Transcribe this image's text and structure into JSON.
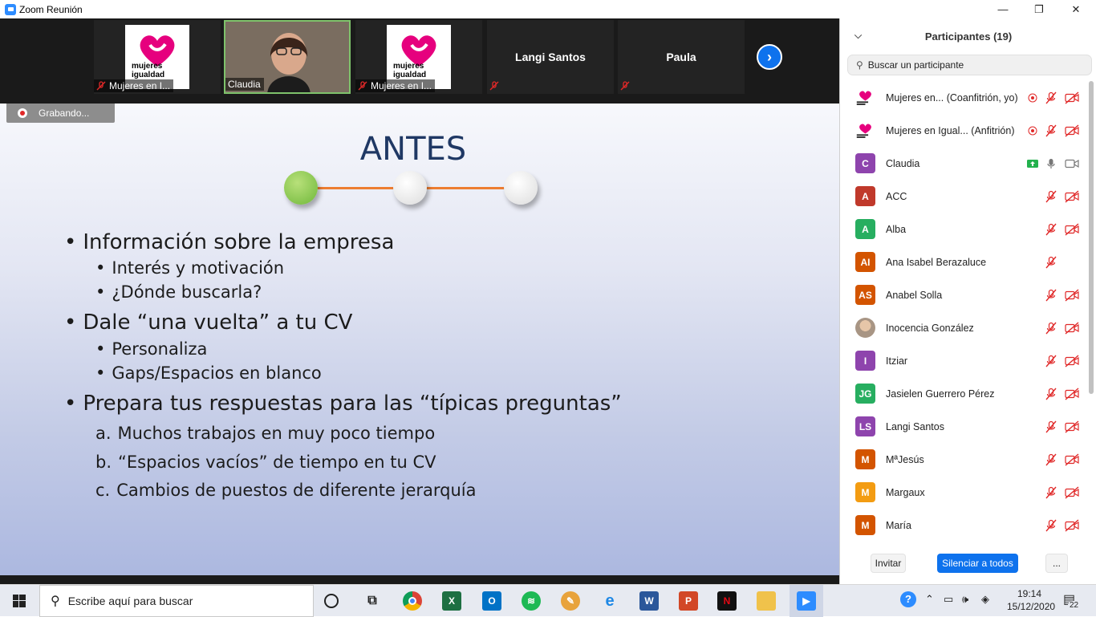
{
  "window": {
    "title": "Zoom Reunión",
    "minimize": "—",
    "maximize": "❐",
    "close": "✕"
  },
  "video_strip": {
    "tiles": [
      {
        "name": "Mujeres en I...",
        "type": "logo",
        "muted": true
      },
      {
        "name": "Claudia",
        "type": "video",
        "muted": false,
        "active": true
      },
      {
        "name": "Mujeres en I...",
        "type": "logo",
        "muted": true
      },
      {
        "name": "Langi Santos",
        "type": "name",
        "muted": true
      },
      {
        "name": "Paula",
        "type": "name",
        "muted": true
      }
    ],
    "logo_text": [
      "mujeres",
      "igualdad"
    ]
  },
  "recording": {
    "label": "Grabando..."
  },
  "slide": {
    "title": "ANTES",
    "bullets": [
      {
        "marker": "•",
        "text": "Información sobre la empresa",
        "level": 1
      },
      {
        "marker": "•",
        "text": "Interés y motivación",
        "level": 2
      },
      {
        "marker": "•",
        "text": "¿Dónde buscarla?",
        "level": 2
      },
      {
        "marker": "•",
        "text": "Dale “una vuelta” a tu CV",
        "level": 1
      },
      {
        "marker": "•",
        "text": "Personaliza",
        "level": 2
      },
      {
        "marker": "•",
        "text": "Gaps/Espacios en blanco",
        "level": 2
      },
      {
        "marker": "•",
        "text": "Prepara tus respuestas para las “típicas preguntas”",
        "level": 1
      },
      {
        "marker": "a.",
        "text": "Muchos trabajos en muy poco tiempo",
        "level": 2
      },
      {
        "marker": "b.",
        "text": "“Espacios vacíos” de tiempo en tu CV",
        "level": 2
      },
      {
        "marker": "c.",
        "text": "Cambios de puestos de diferente jerarquía",
        "level": 2
      }
    ],
    "colors": {
      "title": "#1f3864",
      "line": "#ed7d31",
      "active_dot": "#7dc142"
    }
  },
  "participants": {
    "header": "Participantes (19)",
    "search_placeholder": "Buscar un participante",
    "list": [
      {
        "initials": "",
        "name": "Mujeres en...",
        "role": "(Coanfitrión, yo)",
        "color": "logo",
        "recording": true,
        "mic": "muted",
        "video": "off"
      },
      {
        "initials": "",
        "name": "Mujeres en Igual...",
        "role": "(Anfitrión)",
        "color": "logo",
        "recording": true,
        "mic": "muted",
        "video": "off"
      },
      {
        "initials": "C",
        "name": "Claudia",
        "role": "",
        "color": "#8e44ad",
        "share": true,
        "mic": "on",
        "video": "on"
      },
      {
        "initials": "A",
        "name": "ACC",
        "role": "",
        "color": "#c0392b",
        "mic": "muted",
        "video": "off"
      },
      {
        "initials": "A",
        "name": "Alba",
        "role": "",
        "color": "#27ae60",
        "mic": "muted",
        "video": "off"
      },
      {
        "initials": "AI",
        "name": "Ana Isabel Berazaluce",
        "role": "",
        "color": "#d35400",
        "mic": "muted",
        "video": "none"
      },
      {
        "initials": "AS",
        "name": "Anabel Solla",
        "role": "",
        "color": "#d35400",
        "mic": "muted",
        "video": "off"
      },
      {
        "initials": "",
        "name": "Inocencia González",
        "role": "",
        "color": "photo",
        "mic": "muted",
        "video": "off"
      },
      {
        "initials": "I",
        "name": "Itziar",
        "role": "",
        "color": "#8e44ad",
        "mic": "muted",
        "video": "off"
      },
      {
        "initials": "JG",
        "name": "Jasielen Guerrero Pérez",
        "role": "",
        "color": "#27ae60",
        "mic": "muted",
        "video": "off"
      },
      {
        "initials": "LS",
        "name": "Langi Santos",
        "role": "",
        "color": "#8e44ad",
        "mic": "muted",
        "video": "off"
      },
      {
        "initials": "M",
        "name": "MªJesús",
        "role": "",
        "color": "#d35400",
        "mic": "muted",
        "video": "off"
      },
      {
        "initials": "M",
        "name": "Margaux",
        "role": "",
        "color": "#f39c12",
        "mic": "muted",
        "video": "off"
      },
      {
        "initials": "M",
        "name": "María",
        "role": "",
        "color": "#d35400",
        "mic": "muted",
        "video": "off"
      }
    ],
    "buttons": {
      "invite": "Invitar",
      "mute_all": "Silenciar a todos",
      "more": "..."
    }
  },
  "taskbar": {
    "search_placeholder": "Escribe aquí para buscar",
    "time": "19:14",
    "date": "15/12/2020",
    "notifications": "22",
    "apps": [
      "cortana",
      "task-view",
      "chrome",
      "excel",
      "outlook",
      "spotify",
      "paint",
      "edge",
      "word",
      "powerpoint",
      "netflix",
      "file-explorer",
      "zoom"
    ]
  }
}
